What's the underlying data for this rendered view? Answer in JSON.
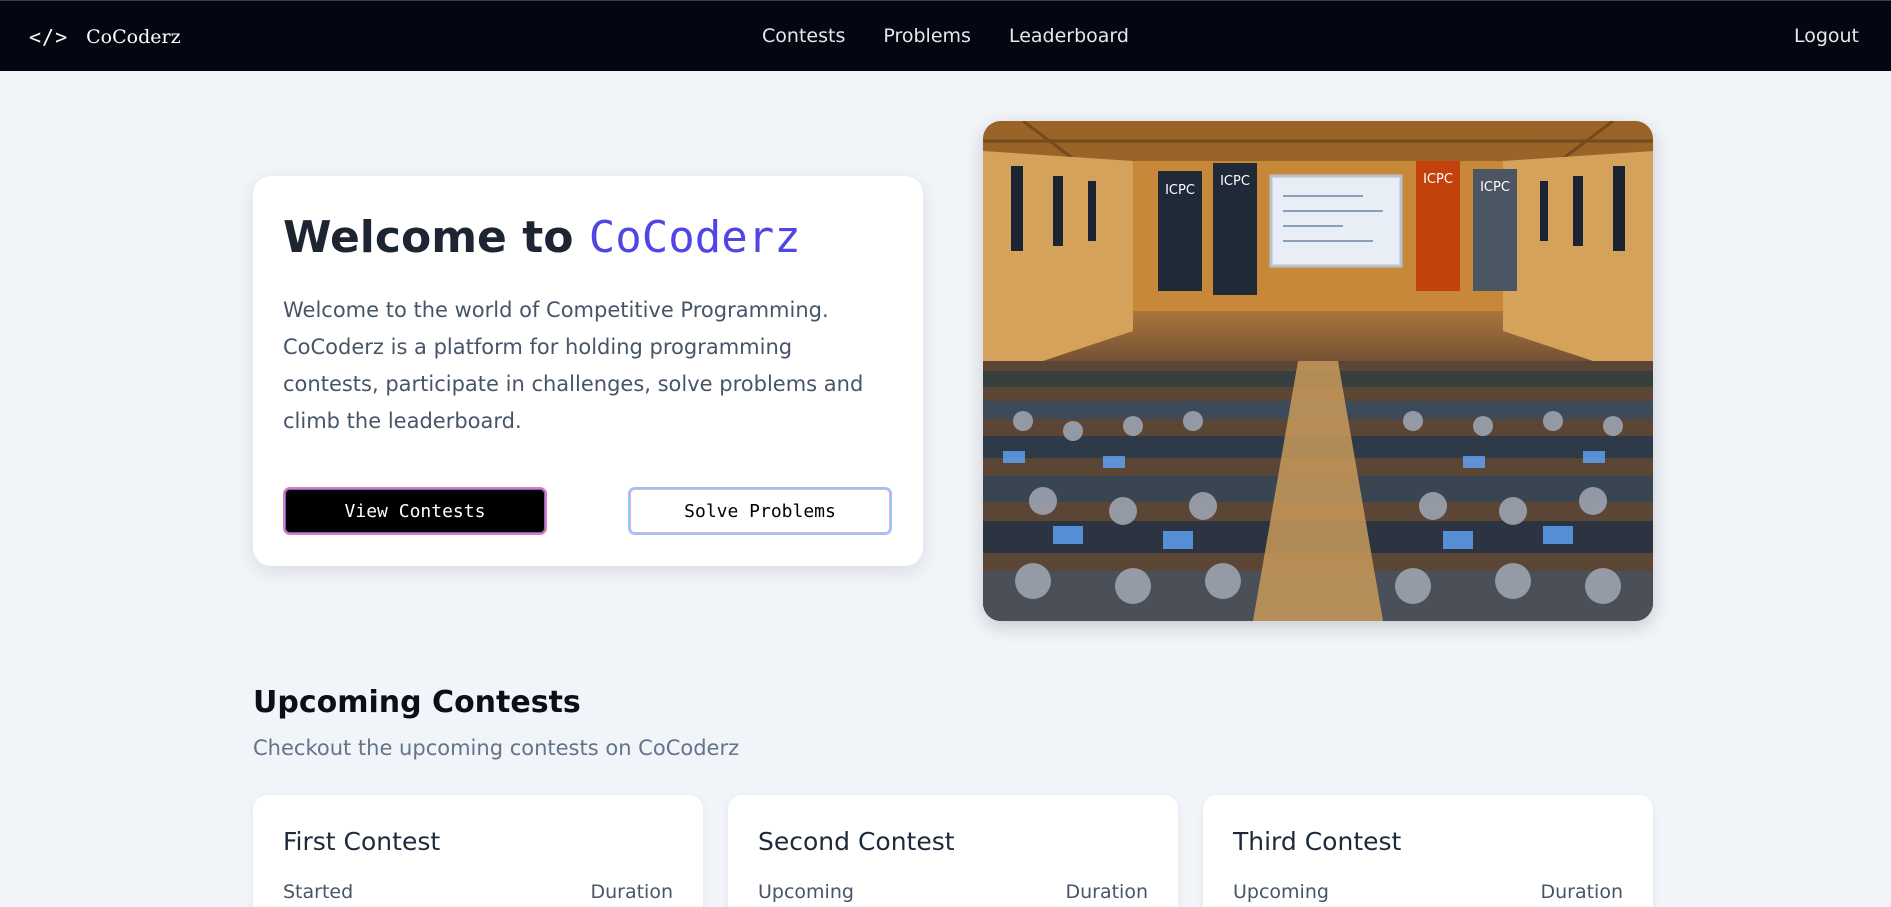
{
  "navbar": {
    "brand_icon": "</>",
    "brand_name": "CoCoderz",
    "links": [
      "Contests",
      "Problems",
      "Leaderboard"
    ],
    "logout": "Logout"
  },
  "hero": {
    "title_prefix": "Welcome to ",
    "title_accent": "CoCoderz",
    "description": "Welcome to the world of Competitive Programming. CoCoderz is a platform for holding programming contests, participate in challenges, solve problems and climb the leaderboard.",
    "primary_button": "View Contests",
    "secondary_button": "Solve Problems",
    "accent_color": "#4f46e5"
  },
  "upcoming": {
    "title": "Upcoming Contests",
    "subtitle": "Checkout the upcoming contests on CoCoderz",
    "contests": [
      {
        "name": "First Contest",
        "status": "Started",
        "duration_label": "Duration"
      },
      {
        "name": "Second Contest",
        "status": "Upcoming",
        "duration_label": "Duration"
      },
      {
        "name": "Third Contest",
        "status": "Upcoming",
        "duration_label": "Duration"
      }
    ]
  },
  "banner_texts": [
    "ICPC",
    "ICPC",
    "ICPC",
    "ICPC"
  ]
}
